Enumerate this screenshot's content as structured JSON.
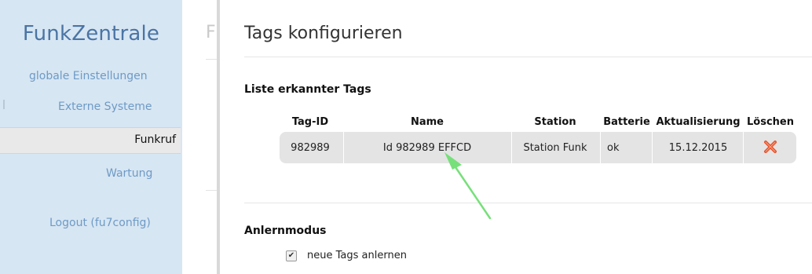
{
  "sidebar": {
    "brand": "FunkZentrale",
    "items": [
      {
        "label": "globale Einstellungen"
      },
      {
        "label": "Externe Systeme"
      },
      {
        "label": "Funkruf"
      },
      {
        "label": "Wartung"
      },
      {
        "label": "Logout (fu7config)"
      }
    ]
  },
  "middle": {
    "letter": "F"
  },
  "main": {
    "title": "Tags konfigurieren",
    "tags_section": "Liste erkannter Tags",
    "table": {
      "headers": [
        "Tag-ID",
        "Name",
        "Station",
        "Batterie",
        "Aktualisierung",
        "Löschen"
      ],
      "rows": [
        {
          "tag_id": "982989",
          "name": "Id 982989 EFFCD",
          "station": "Station Funk",
          "battery": "ok",
          "updated": "15.12.2015"
        }
      ]
    },
    "learn_section": "Anlernmodus",
    "learn_checkbox": {
      "label": "neue Tags anlernen",
      "checked": "✔"
    }
  },
  "colors": {
    "sidebar_bg": "#d7e6f3",
    "brand": "#4a74a4",
    "nav_link": "#6e9ac6",
    "row_bg": "#e4e4e4",
    "delete": "#e8502a",
    "arrow": "#77e07a"
  },
  "icons": {
    "delete": "close-x-icon",
    "annotation": "arrow-icon"
  }
}
